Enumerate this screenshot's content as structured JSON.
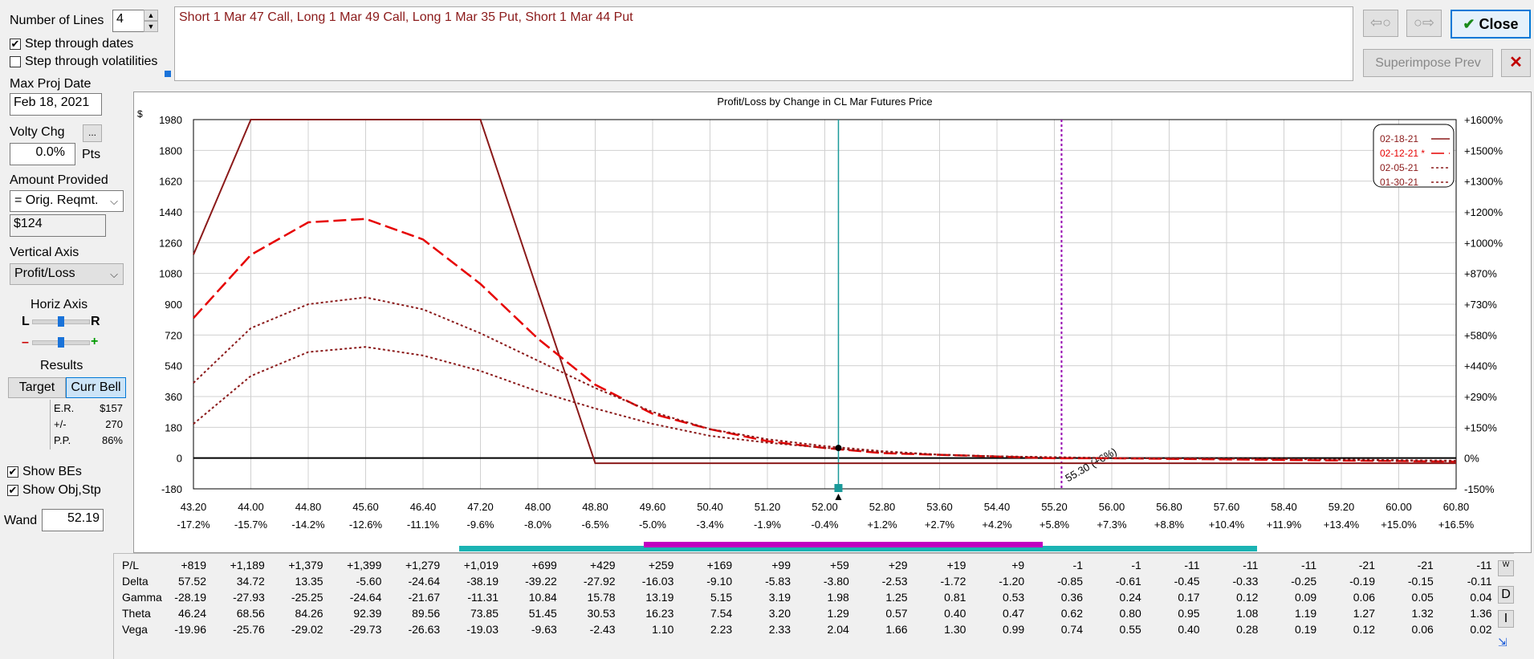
{
  "left": {
    "lines_label": "Number of Lines",
    "lines_value": "4",
    "step_dates_label": "Step through dates",
    "step_dates_checked": true,
    "step_vol_label": "Step through volatilities",
    "step_vol_checked": false,
    "max_proj_label": "Max Proj Date",
    "max_proj_value": "Feb 18, 2021",
    "volty_label": "Volty Chg",
    "volty_value": "0.0%",
    "volty_unit": "Pts",
    "volty_more": "...",
    "amount_label": "Amount Provided",
    "amount_select": "= Orig. Reqmt.",
    "amount_value": "$124",
    "vaxis_label": "Vertical Axis",
    "vaxis_select": "Profit/Loss",
    "haxis_label": "Horiz Axis",
    "haxis_l": "L",
    "haxis_r": "R",
    "haxis_minus": "–",
    "haxis_plus": "+",
    "results_label": "Results",
    "target_label": "Target",
    "currbell_label": "Curr Bell",
    "er_label": "E.R.",
    "er_value": "$157",
    "pm_label": "+/-",
    "pm_value": "270",
    "pp_label": "P.P.",
    "pp_value": "86%",
    "show_bes_label": "Show BEs",
    "show_bes_checked": true,
    "show_obj_label": "Show Obj,Stp",
    "show_obj_checked": true,
    "wand_label": "Wand",
    "wand_value": "52.19"
  },
  "top": {
    "strategy_text": "Short 1 Mar 47 Call, Long 1 Mar 49 Call, Long 1 Mar 35 Put, Short 1 Mar 44 Put",
    "back_icon": "⇦○",
    "fwd_icon": "○⇨",
    "close_label": "Close",
    "superimpose_label": "Superimpose Prev",
    "x_label": "✕"
  },
  "chart_data": {
    "type": "line",
    "title": "Profit/Loss by Change in CL Mar Futures Price",
    "ylabel": "$",
    "x_ticks": [
      "43.20",
      "44.00",
      "44.80",
      "45.60",
      "46.40",
      "47.20",
      "48.00",
      "48.80",
      "49.60",
      "50.40",
      "51.20",
      "52.00",
      "52.80",
      "53.60",
      "54.40",
      "55.20",
      "56.00",
      "56.80",
      "57.60",
      "58.40",
      "59.20",
      "60.00",
      "60.80"
    ],
    "x_pct_ticks": [
      "-17.2%",
      "-15.7%",
      "-14.2%",
      "-12.6%",
      "-11.1%",
      "-9.6%",
      "-8.0%",
      "-6.5%",
      "-5.0%",
      "-3.4%",
      "-1.9%",
      "-0.4%",
      "+1.2%",
      "+2.7%",
      "+4.2%",
      "+5.8%",
      "+7.3%",
      "+8.8%",
      "+10.4%",
      "+11.9%",
      "+13.4%",
      "+15.0%",
      "+16.5%"
    ],
    "y_ticks": [
      "1980",
      "1800",
      "1620",
      "1440",
      "1260",
      "1080",
      "900",
      "720",
      "540",
      "360",
      "180",
      "0",
      "-180"
    ],
    "y_pct_ticks": [
      "+1600%",
      "+1500%",
      "+1300%",
      "+1200%",
      "+1000%",
      "+870%",
      "+730%",
      "+580%",
      "+440%",
      "+290%",
      "+150%",
      "0%",
      "-150%"
    ],
    "xlim": [
      43.2,
      60.8
    ],
    "ylim": [
      -180,
      1980
    ],
    "current_price": 52.19,
    "objective_line": 55.3,
    "objective_label": "55.30 (+6%)",
    "series": [
      {
        "name": "02-18-21",
        "style": "solid",
        "x": [
          43.2,
          44.0,
          47.2,
          48.8,
          60.8
        ],
        "y": [
          1190,
          1980,
          1980,
          -30,
          -30
        ]
      },
      {
        "name": "02-12-21 *",
        "style": "longdash",
        "x": [
          43.2,
          44.0,
          44.8,
          45.6,
          46.4,
          47.2,
          48.0,
          48.8,
          49.6,
          50.4,
          51.2,
          52.0,
          52.8,
          53.6,
          54.4,
          55.2,
          56.0,
          58.4,
          60.8
        ],
        "y": [
          819,
          1189,
          1379,
          1399,
          1279,
          1019,
          699,
          429,
          259,
          169,
          99,
          59,
          29,
          19,
          9,
          -1,
          -1,
          -11,
          -21
        ]
      },
      {
        "name": "02-05-21",
        "style": "dotted",
        "x": [
          43.2,
          44.0,
          44.8,
          45.6,
          46.4,
          47.2,
          48.0,
          48.8,
          49.6,
          50.4,
          51.2,
          52.0,
          52.8,
          53.6,
          54.4,
          55.2,
          56.0,
          58.4,
          60.8
        ],
        "y": [
          440,
          760,
          900,
          940,
          870,
          730,
          570,
          410,
          270,
          170,
          110,
          70,
          40,
          20,
          10,
          5,
          0,
          -5,
          -20
        ]
      },
      {
        "name": "01-30-21",
        "style": "dotted",
        "x": [
          43.2,
          44.0,
          44.8,
          45.6,
          46.4,
          47.2,
          48.0,
          48.8,
          49.6,
          50.4,
          51.2,
          52.0,
          52.8,
          53.6,
          54.4,
          55.2,
          56.0,
          58.4,
          60.8
        ],
        "y": [
          200,
          480,
          620,
          650,
          600,
          510,
          390,
          290,
          200,
          130,
          90,
          60,
          35,
          20,
          10,
          5,
          0,
          -5,
          -15
        ]
      }
    ],
    "legend_position": "top-right",
    "grid": true
  },
  "colors": {
    "series1": "#8b1a1a",
    "series2": "#e60000",
    "series3": "#8b1a1a",
    "series4": "#8b1a1a",
    "cursor": "#1a9a9a",
    "objective": "#9400b0",
    "strategy_text": "#8b1a1a",
    "band_outer": "#1ab3b3",
    "band_inner": "#c000c0"
  },
  "table": {
    "rows": [
      {
        "label": "P/L",
        "values": [
          "+819",
          "+1,189",
          "+1,379",
          "+1,399",
          "+1,279",
          "+1,019",
          "+699",
          "+429",
          "+259",
          "+169",
          "+99",
          "+59",
          "+29",
          "+19",
          "+9",
          "-1",
          "-1",
          "-11",
          "-11",
          "-11",
          "-21",
          "-21",
          "-11"
        ]
      },
      {
        "label": "Delta",
        "values": [
          "57.52",
          "34.72",
          "13.35",
          "-5.60",
          "-24.64",
          "-38.19",
          "-39.22",
          "-27.92",
          "-16.03",
          "-9.10",
          "-5.83",
          "-3.80",
          "-2.53",
          "-1.72",
          "-1.20",
          "-0.85",
          "-0.61",
          "-0.45",
          "-0.33",
          "-0.25",
          "-0.19",
          "-0.15",
          "-0.11"
        ]
      },
      {
        "label": "Gamma",
        "values": [
          "-28.19",
          "-27.93",
          "-25.25",
          "-24.64",
          "-21.67",
          "-11.31",
          "10.84",
          "15.78",
          "13.19",
          "5.15",
          "3.19",
          "1.98",
          "1.25",
          "0.81",
          "0.53",
          "0.36",
          "0.24",
          "0.17",
          "0.12",
          "0.09",
          "0.06",
          "0.05",
          "0.04"
        ]
      },
      {
        "label": "Theta",
        "values": [
          "46.24",
          "68.56",
          "84.26",
          "92.39",
          "89.56",
          "73.85",
          "51.45",
          "30.53",
          "16.23",
          "7.54",
          "3.20",
          "1.29",
          "0.57",
          "0.40",
          "0.47",
          "0.62",
          "0.80",
          "0.95",
          "1.08",
          "1.19",
          "1.27",
          "1.32",
          "1.36"
        ]
      },
      {
        "label": "Vega",
        "values": [
          "-19.96",
          "-25.76",
          "-29.02",
          "-29.73",
          "-26.63",
          "-19.03",
          "-9.63",
          "-2.43",
          "1.10",
          "2.23",
          "2.33",
          "2.04",
          "1.66",
          "1.30",
          "0.99",
          "0.74",
          "0.55",
          "0.40",
          "0.28",
          "0.19",
          "0.12",
          "0.06",
          "0.02"
        ]
      }
    ],
    "side_w": "W",
    "side_d": "D",
    "side_i": "I"
  }
}
